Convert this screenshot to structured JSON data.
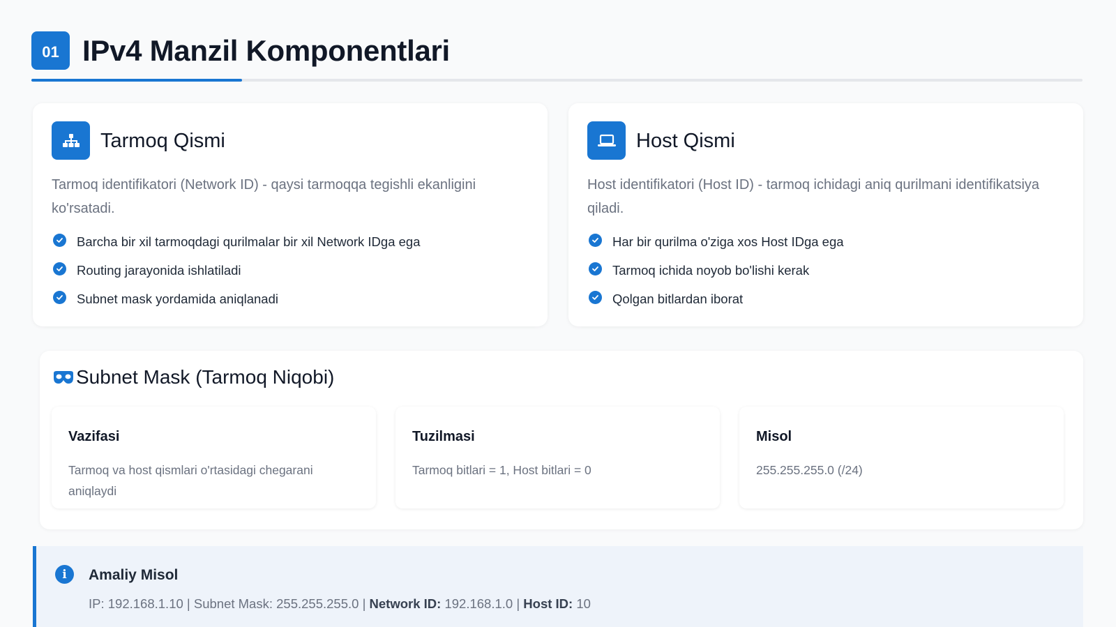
{
  "section": {
    "number": "01",
    "title": "IPv4 Manzil Komponentlari"
  },
  "network_card": {
    "icon": "network-hierarchy-icon",
    "title": "Tarmoq Qismi",
    "description": "Tarmoq identifikatori (Network ID) - qaysi tarmoqqa tegishli ekanligini ko'rsatadi.",
    "items": [
      "Barcha bir xil tarmoqdagi qurilmalar bir xil Network IDga ega",
      "Routing jarayonida ishlatiladi",
      "Subnet mask yordamida aniqlanadi"
    ]
  },
  "host_card": {
    "icon": "laptop-icon",
    "title": "Host Qismi",
    "description": "Host identifikatori (Host ID) - tarmoq ichidagi aniq qurilmani identifikatsiya qiladi.",
    "items": [
      "Har bir qurilma o'ziga xos Host IDga ega",
      "Tarmoq ichida noyob bo'lishi kerak",
      "Qolgan bitlardan iborat"
    ]
  },
  "subnet_mask": {
    "icon": "mask-icon",
    "title": "Subnet Mask (Tarmoq Niqobi)",
    "boxes": [
      {
        "title": "Vazifasi",
        "text": "Tarmoq va host qismlari o'rtasidagi chegarani aniqlaydi"
      },
      {
        "title": "Tuzilmasi",
        "text": "Tarmoq bitlari = 1, Host bitlari = 0"
      },
      {
        "title": "Misol",
        "text": "255.255.255.0 (/24)"
      }
    ]
  },
  "example": {
    "icon": "info-icon",
    "title": "Amaliy Misol",
    "ip_text": "IP: 192.168.1.10 | Subnet Mask: 255.255.255.0 |",
    "network_label": "Network ID:",
    "network_value": "192.168.1.0 |",
    "host_label": "Host ID:",
    "host_value": "10"
  },
  "colors": {
    "accent": "#1976d2",
    "background": "#f9fafb",
    "muted_text": "#6b7280"
  }
}
